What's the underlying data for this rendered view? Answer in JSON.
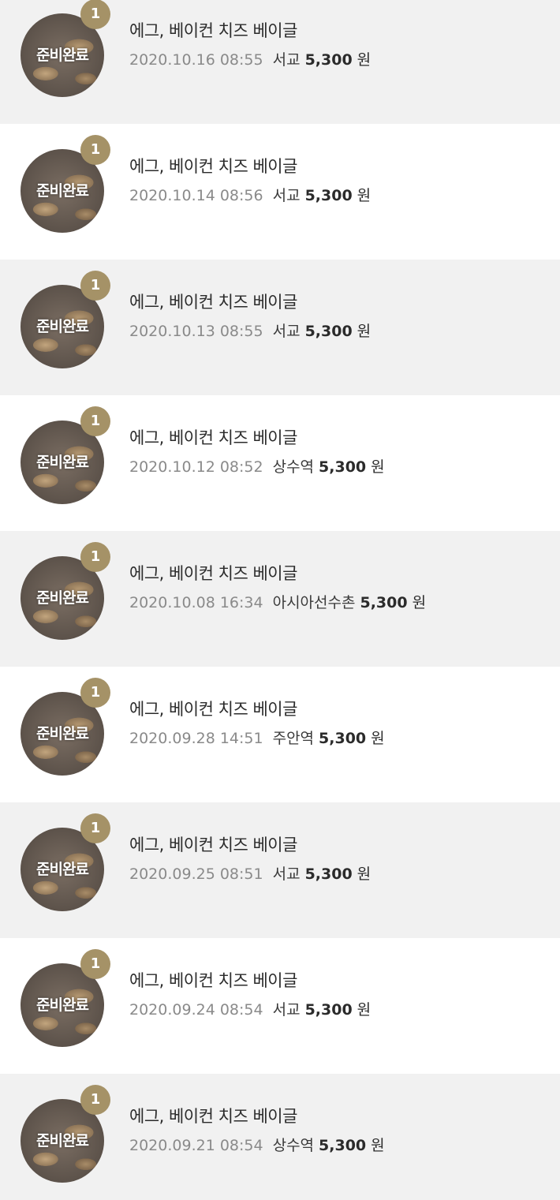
{
  "orders": [
    {
      "status": "준비완료",
      "quantity": "1",
      "name": "에그, 베이컨 치즈 베이글",
      "datetime": "2020.10.16 08:55",
      "store": "서교",
      "price": "5,300",
      "currency": "원"
    },
    {
      "status": "준비완료",
      "quantity": "1",
      "name": "에그, 베이컨 치즈 베이글",
      "datetime": "2020.10.14 08:56",
      "store": "서교",
      "price": "5,300",
      "currency": "원"
    },
    {
      "status": "준비완료",
      "quantity": "1",
      "name": "에그, 베이컨 치즈 베이글",
      "datetime": "2020.10.13 08:55",
      "store": "서교",
      "price": "5,300",
      "currency": "원"
    },
    {
      "status": "준비완료",
      "quantity": "1",
      "name": "에그, 베이컨 치즈 베이글",
      "datetime": "2020.10.12 08:52",
      "store": "상수역",
      "price": "5,300",
      "currency": "원"
    },
    {
      "status": "준비완료",
      "quantity": "1",
      "name": "에그, 베이컨 치즈 베이글",
      "datetime": "2020.10.08 16:34",
      "store": "아시아선수촌",
      "price": "5,300",
      "currency": "원"
    },
    {
      "status": "준비완료",
      "quantity": "1",
      "name": "에그, 베이컨 치즈 베이글",
      "datetime": "2020.09.28 14:51",
      "store": "주안역",
      "price": "5,300",
      "currency": "원"
    },
    {
      "status": "준비완료",
      "quantity": "1",
      "name": "에그, 베이컨 치즈 베이글",
      "datetime": "2020.09.25 08:51",
      "store": "서교",
      "price": "5,300",
      "currency": "원"
    },
    {
      "status": "준비완료",
      "quantity": "1",
      "name": "에그, 베이컨 치즈 베이글",
      "datetime": "2020.09.24 08:54",
      "store": "서교",
      "price": "5,300",
      "currency": "원"
    },
    {
      "status": "준비완료",
      "quantity": "1",
      "name": "에그, 베이컨 치즈 베이글",
      "datetime": "2020.09.21 08:54",
      "store": "상수역",
      "price": "5,300",
      "currency": "원"
    }
  ],
  "colors": {
    "shaded_row": "#f1f1f1",
    "badge": "#a59267"
  }
}
